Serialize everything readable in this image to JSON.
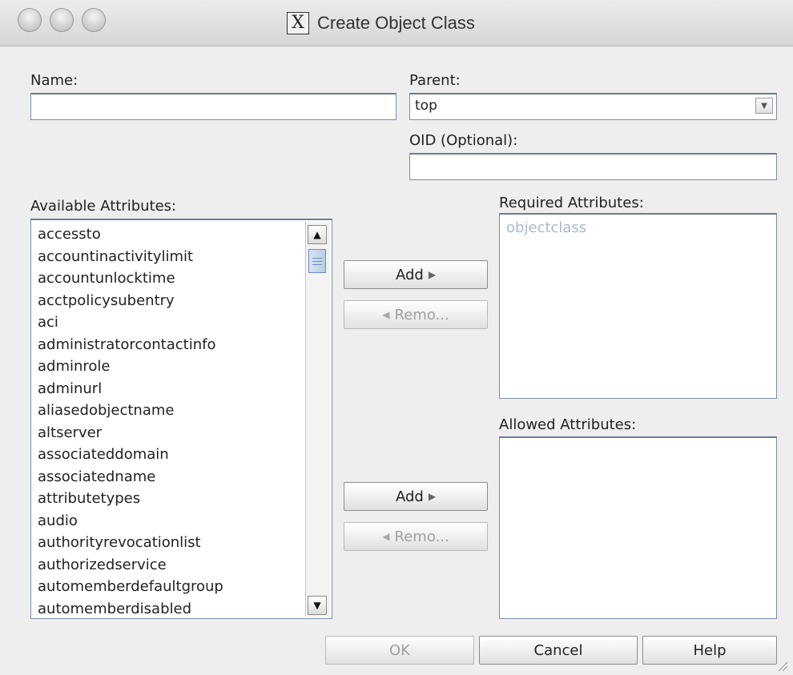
{
  "window": {
    "title": "Create Object Class",
    "app_icon": "x11-icon"
  },
  "form": {
    "name_label": "Name:",
    "name_value": "",
    "parent_label": "Parent:",
    "parent_value": "top",
    "oid_label": "OID (Optional):",
    "oid_value": ""
  },
  "available": {
    "label": "Available Attributes:",
    "items": [
      "accessto",
      "accountinactivitylimit",
      "accountunlocktime",
      "acctpolicysubentry",
      "aci",
      "administratorcontactinfo",
      "adminrole",
      "adminurl",
      "aliasedobjectname",
      "altserver",
      "associateddomain",
      "associatedname",
      "attributetypes",
      "audio",
      "authorityrevocationlist",
      "authorizedservice",
      "automemberdefaultgroup",
      "automemberdisabled"
    ]
  },
  "required": {
    "label": "Required Attributes:",
    "items": [
      "objectclass"
    ]
  },
  "allowed": {
    "label": "Allowed Attributes:",
    "items": []
  },
  "buttons": {
    "add_required": "Add",
    "remove_required": "Remo...",
    "add_allowed": "Add",
    "remove_allowed": "Remo...",
    "ok": "OK",
    "cancel": "Cancel",
    "help": "Help"
  }
}
